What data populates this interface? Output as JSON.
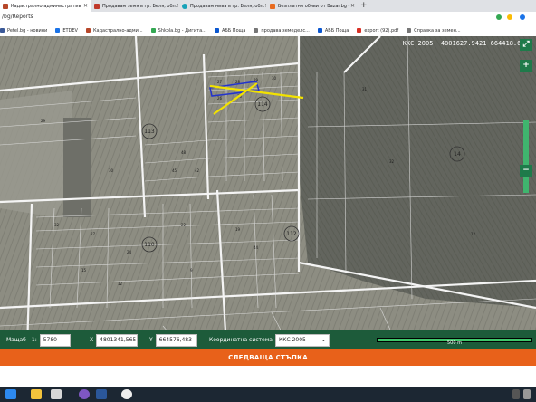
{
  "browser": {
    "tabs": [
      {
        "label": "Кадастрално-административ",
        "color": "#b7472a"
      },
      {
        "label": "Продавам земя в гр. Беля, обл.",
        "color": "#c0392b"
      },
      {
        "label": "Продавам нива в гр. Беля, обл.",
        "color": "#17a2b8"
      },
      {
        "label": "Безплатни обяви от Bazar.bg -",
        "color": "#e86b1f"
      }
    ],
    "url": "/bg/Reports",
    "bookmarks": [
      {
        "label": "Petel.bg - новини",
        "color": "#3b5998"
      },
      {
        "label": "ETDEV",
        "color": "#1a73e8"
      },
      {
        "label": "Кадастрално-адми...",
        "color": "#b7472a"
      },
      {
        "label": "Shkola.bg - Дигита...",
        "color": "#34a853"
      },
      {
        "label": "АББ Поща",
        "color": "#0b57d0"
      },
      {
        "label": "продава земеделс...",
        "color": "#777"
      },
      {
        "label": "АББ Поща",
        "color": "#0b57d0"
      },
      {
        "label": "export (92).pdf",
        "color": "#d93025"
      },
      {
        "label": "Справка за земен...",
        "color": "#777"
      }
    ]
  },
  "map": {
    "coord_readout": "ККС 2005: 4801627.9421 664418.6573",
    "parcel_labels": [
      "113",
      "114",
      "112",
      "110",
      "16",
      "16",
      "14",
      "27",
      "28",
      "29",
      "30"
    ],
    "zoom_in": "+",
    "zoom_out": "−",
    "fullscreen": "⤢"
  },
  "controls": {
    "scale_label": "Мащаб",
    "scale_prefix": "1:",
    "scale_value": "5780",
    "x_label": "X",
    "x_value": "4801341,565",
    "y_label": "Y",
    "y_value": "664576,483",
    "crs_label": "Координатна система",
    "crs_value": "ККС 2005",
    "scalebar_label": "500 m"
  },
  "next_step": "СЛЕДВАЩА СТЪПКА"
}
